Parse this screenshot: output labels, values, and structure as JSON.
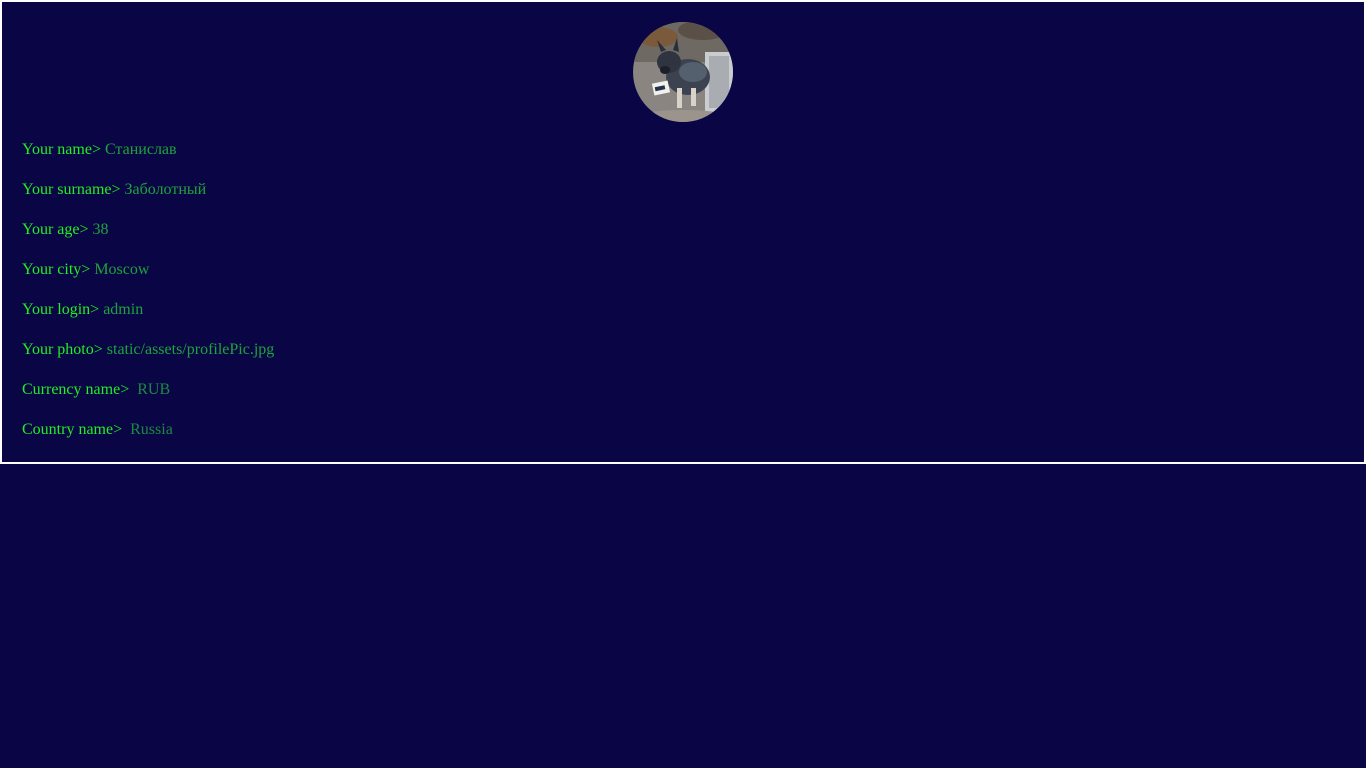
{
  "profile": {
    "avatar_alt": "Profile photo",
    "fields": [
      {
        "label": "Your name",
        "value": "Станислав"
      },
      {
        "label": "Your surname",
        "value": "Заболотный"
      },
      {
        "label": "Your age",
        "value": "38"
      },
      {
        "label": "Your city",
        "value": "Moscow"
      },
      {
        "label": "Your login",
        "value": "admin"
      },
      {
        "label": "Your photo",
        "value": "static/assets/profilePic.jpg"
      },
      {
        "label": "Currency name",
        "value": "RUB"
      },
      {
        "label": "Country name",
        "value": "Russia"
      }
    ],
    "separator": ">"
  },
  "colors": {
    "background": "#0a0646",
    "label": "#22ee22",
    "value": "#1da33b",
    "border": "#ffffff"
  }
}
